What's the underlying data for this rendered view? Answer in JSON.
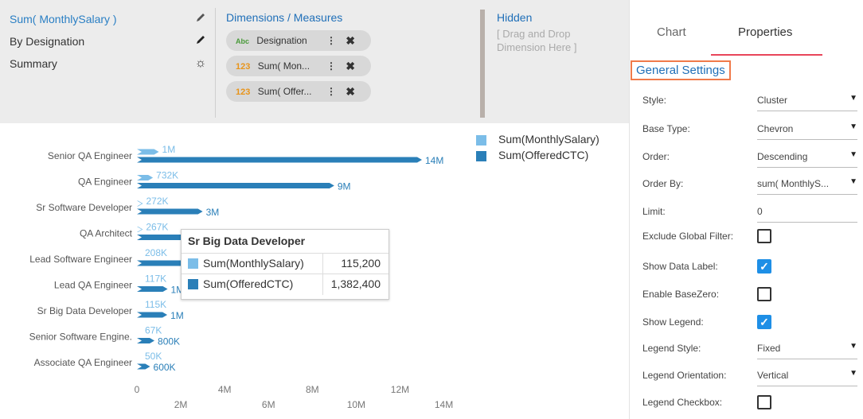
{
  "panel": {
    "items": [
      {
        "label": "Sum( MonthlySalary )",
        "icon": "pencil-icon"
      },
      {
        "label": "By Designation",
        "icon": "pencil-icon"
      },
      {
        "label": "Summary",
        "icon": "gear-icon"
      }
    ],
    "dims_header": "Dimensions / Measures",
    "pills": [
      {
        "type": "Abc",
        "label": "Designation"
      },
      {
        "type": "123",
        "label": "Sum( Mon..."
      },
      {
        "type": "123",
        "label": "Sum( Offer..."
      }
    ],
    "hidden_header": "Hidden",
    "hidden_placeholder": "[ Drag and Drop Dimension Here ]"
  },
  "sidebar": {
    "tabs": [
      "Chart",
      "Properties"
    ],
    "active_tab": "Properties",
    "section_title": "General Settings",
    "properties": [
      {
        "label": "Style:",
        "value": "Cluster",
        "kind": "dropdown"
      },
      {
        "label": "Base Type:",
        "value": "Chevron",
        "kind": "dropdown"
      },
      {
        "label": "Order:",
        "value": "Descending",
        "kind": "dropdown"
      },
      {
        "label": "Order By:",
        "value": "sum( MonthlyS...",
        "kind": "dropdown"
      },
      {
        "label": "Limit:",
        "value": "0",
        "kind": "input"
      },
      {
        "label": "Exclude Global Filter:",
        "checked": false,
        "kind": "checkbox"
      },
      {
        "label": "Show Data Label:",
        "checked": true,
        "kind": "checkbox"
      },
      {
        "label": "Enable BaseZero:",
        "checked": false,
        "kind": "checkbox"
      },
      {
        "label": "Show Legend:",
        "checked": true,
        "kind": "checkbox"
      },
      {
        "label": "Legend Style:",
        "value": "Fixed",
        "kind": "dropdown"
      },
      {
        "label": "Legend Orientation:",
        "value": "Vertical",
        "kind": "dropdown"
      },
      {
        "label": "Legend Checkbox:",
        "checked": false,
        "kind": "checkbox"
      }
    ]
  },
  "tooltip": {
    "title": "Sr Big Data Developer",
    "rows": [
      {
        "name": "Sum(MonthlySalary)",
        "value": "115,200"
      },
      {
        "name": "Sum(OfferedCTC)",
        "value": "1,382,400"
      }
    ]
  },
  "colors": {
    "salary": "#7bbde8",
    "ctc": "#2a7fb8"
  },
  "chart_data": {
    "type": "bar",
    "orientation": "horizontal",
    "categories": [
      "Senior QA Engineer",
      "QA Engineer",
      "Sr Software Developer",
      "QA Architect",
      "Lead Software Engineer",
      "Lead QA Engineer",
      "Sr Big Data Developer",
      "Senior Software Engine.",
      "Associate QA Engineer"
    ],
    "series": [
      {
        "name": "Sum(MonthlySalary)",
        "values": [
          1000000,
          732000,
          272000,
          267000,
          208000,
          117000,
          115200,
          67000,
          50000
        ],
        "labels": [
          "1M",
          "732K",
          "272K",
          "267K",
          "208K",
          "117K",
          "115K",
          "67K",
          "50K"
        ]
      },
      {
        "name": "Sum(OfferedCTC)",
        "values": [
          13000000,
          9000000,
          3000000,
          3200000,
          2500000,
          1400000,
          1382400,
          800000,
          600000
        ],
        "labels": [
          "14M",
          "9M",
          "3M",
          "",
          "",
          "1M",
          "1M",
          "800K",
          "600K"
        ]
      }
    ],
    "xlim": [
      0,
      14000000
    ],
    "xticks_top": [
      "0",
      "4M",
      "8M",
      "12M"
    ],
    "xticks_bottom": [
      "2M",
      "6M",
      "10M",
      "14M"
    ],
    "legend": "top-right"
  }
}
